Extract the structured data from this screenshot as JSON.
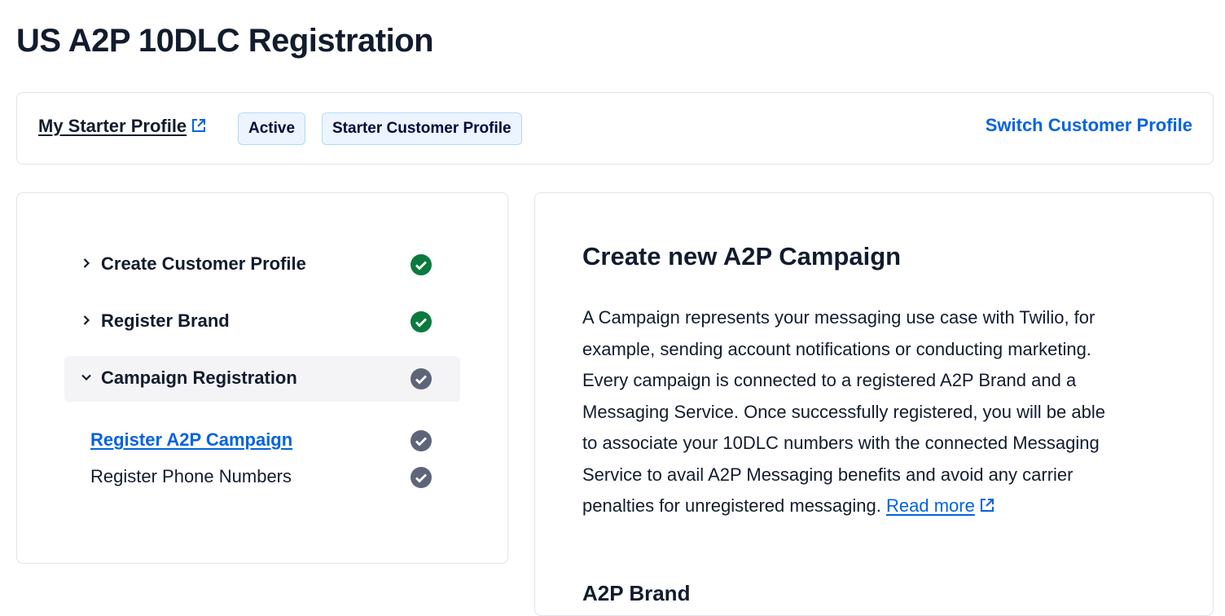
{
  "page": {
    "title": "US A2P 10DLC Registration"
  },
  "profile_bar": {
    "profile_name": "My Starter Profile",
    "status_badge": "Active",
    "type_badge": "Starter Customer Profile",
    "switch_label": "Switch Customer Profile"
  },
  "steps": {
    "items": [
      {
        "label": "Create Customer Profile",
        "status": "complete"
      },
      {
        "label": "Register Brand",
        "status": "complete"
      },
      {
        "label": "Campaign Registration",
        "status": "in-progress"
      }
    ],
    "substeps": [
      {
        "label": "Register A2P Campaign",
        "status": "in-progress"
      },
      {
        "label": "Register Phone Numbers",
        "status": "in-progress"
      }
    ]
  },
  "content": {
    "title": "Create new A2P Campaign",
    "body": "A Campaign represents your messaging use case with Twilio, for example, sending account notifications or conducting marketing. Every campaign is connected to a registered A2P Brand and a Messaging Service. Once successfully registered, you will be able to associate your 10DLC numbers with the connected Messaging Service to avail A2P Messaging benefits and avoid any carrier penalties for unregistered messaging.",
    "read_more": "Read more",
    "next_heading": "A2P Brand"
  },
  "colors": {
    "link": "#0263e0",
    "success": "#0a7a3e",
    "pending": "#5f6578",
    "badge_bg": "#ebf4ff",
    "badge_border": "#b0dbf7"
  },
  "icons": {
    "external": "external-link-icon",
    "complete": "check-circle-success-icon",
    "pending": "check-circle-neutral-icon",
    "collapsed": "chevron-right-icon",
    "expanded": "chevron-down-icon"
  }
}
